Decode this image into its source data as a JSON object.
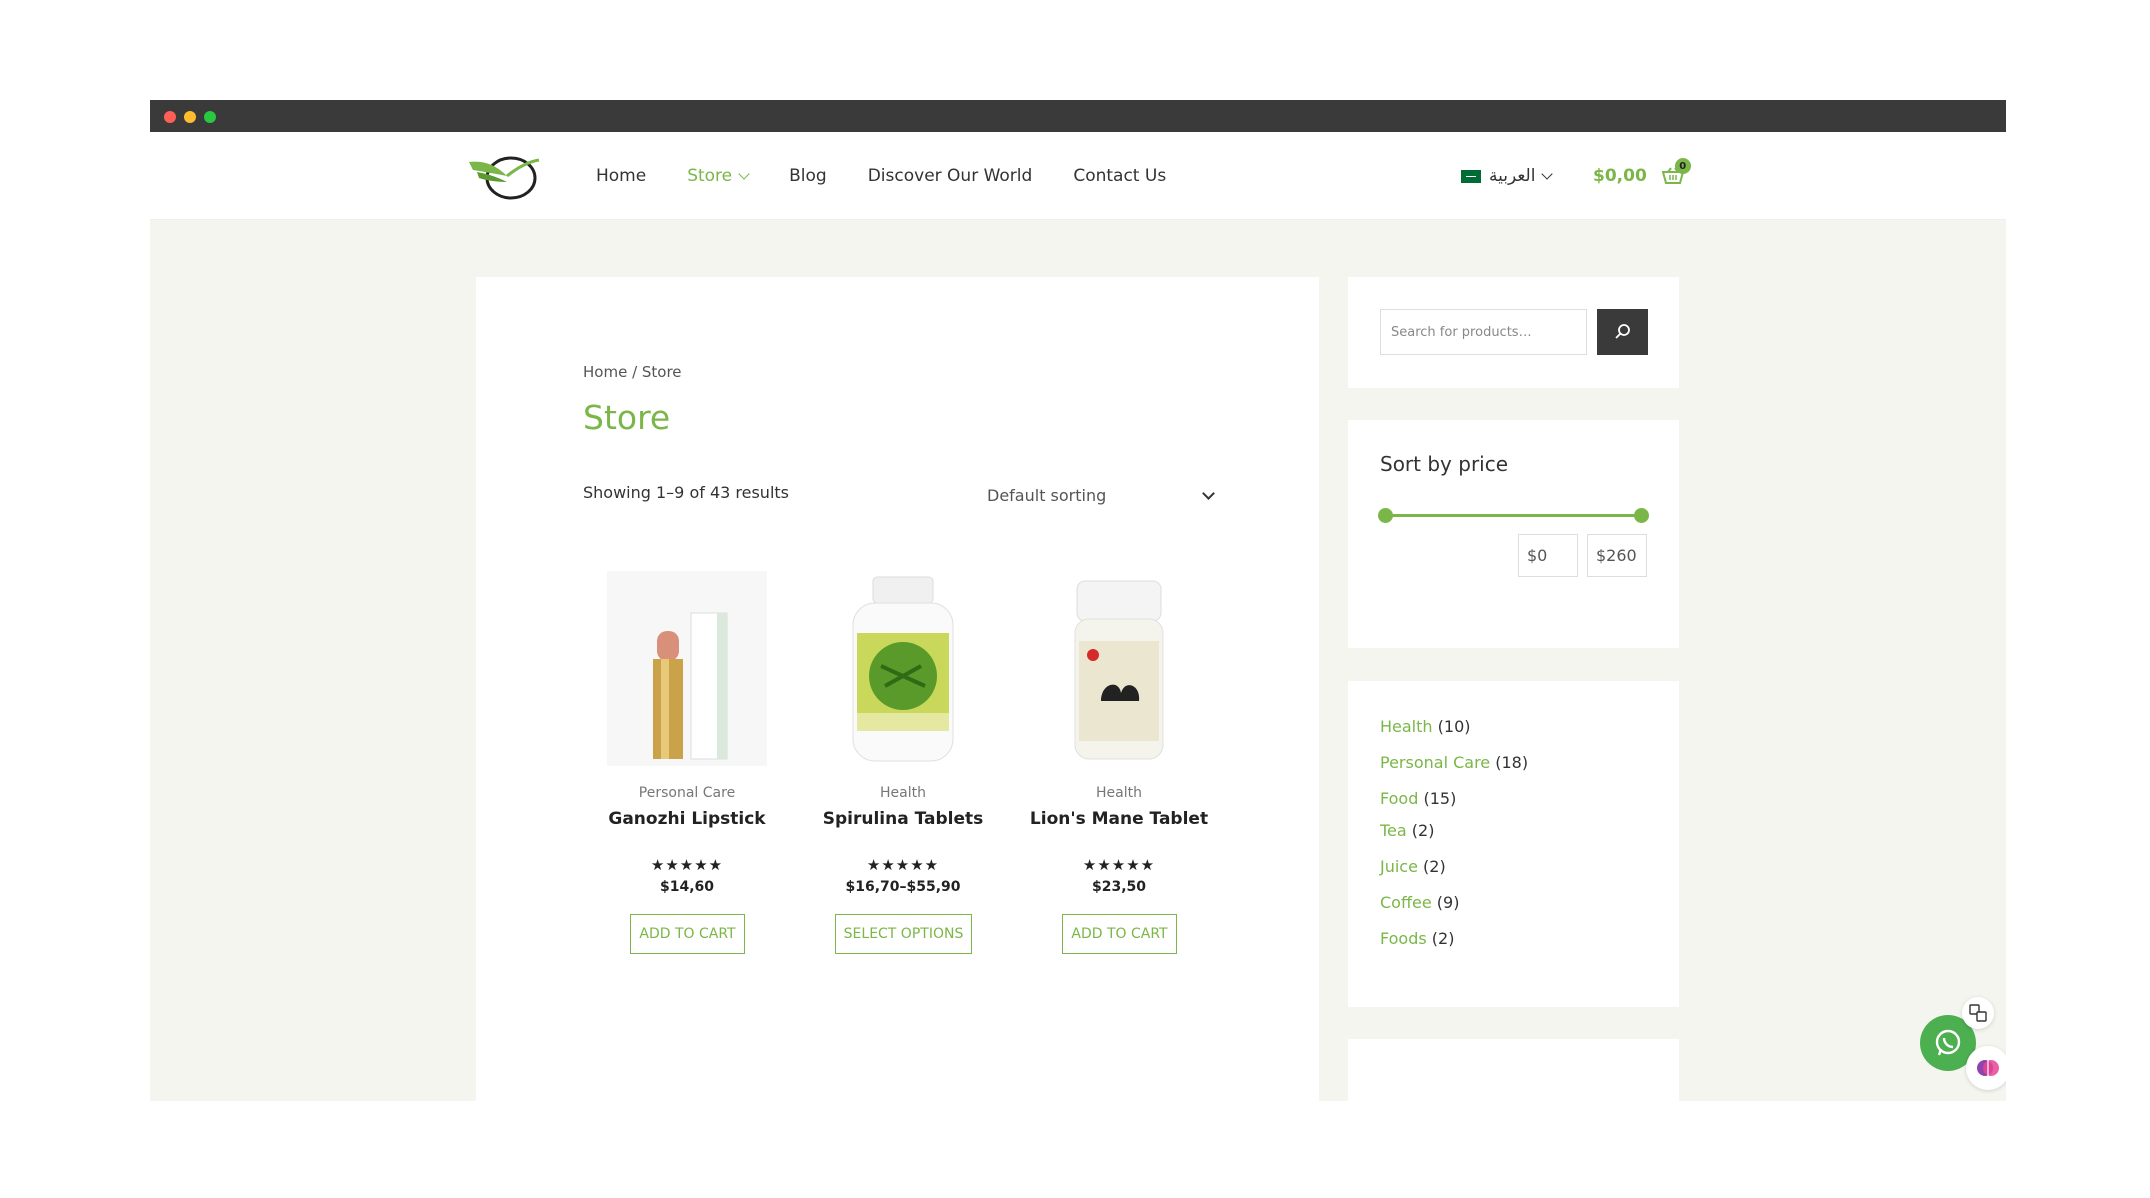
{
  "header": {
    "nav": [
      {
        "label": "Home"
      },
      {
        "label": "Store"
      },
      {
        "label": "Blog"
      },
      {
        "label": "Discover Our World"
      },
      {
        "label": "Contact Us"
      }
    ],
    "language": "العربية",
    "cart_total": "$0,00",
    "cart_count": "0"
  },
  "main": {
    "breadcrumb": "Home / Store",
    "title": "Store",
    "result_count": "Showing 1–9 of 43 results",
    "sorting": "Default sorting",
    "products": [
      {
        "category": "Personal Care",
        "name": "Ganozhi Lipstick",
        "stars": "★★★★★",
        "price": "$14,60",
        "button": "ADD TO CART"
      },
      {
        "category": "Health",
        "name": "Spirulina Tablets",
        "stars": "★★★★★",
        "price": "$16,70–$55,90",
        "button": "SELECT OPTIONS"
      },
      {
        "category": "Health",
        "name": "Lion's Mane Tablet",
        "stars": "★★★★★",
        "price": "$23,50",
        "button": "ADD TO CART"
      }
    ]
  },
  "sidebar": {
    "search_placeholder": "Search for products…",
    "price_filter": {
      "title": "Sort by price",
      "min": "$0",
      "max": "$260"
    },
    "categories": [
      {
        "name": "Health",
        "count": "(10)"
      },
      {
        "name": "Personal Care",
        "count": "(18)"
      },
      {
        "name": "Food",
        "count": "(15)"
      },
      {
        "name": "Tea",
        "count": "(2)"
      },
      {
        "name": "Juice",
        "count": "(2)"
      },
      {
        "name": "Coffee",
        "count": "(9)"
      },
      {
        "name": "Foods",
        "count": "(2)"
      }
    ]
  },
  "colors": {
    "accent": "#7ab648",
    "dark": "#3a3a3a",
    "background": "#f5f5f0"
  },
  "icons": [
    "search-icon",
    "cart-icon",
    "chevron-down-icon",
    "whatsapp-icon",
    "translate-icon",
    "brain-icon"
  ]
}
